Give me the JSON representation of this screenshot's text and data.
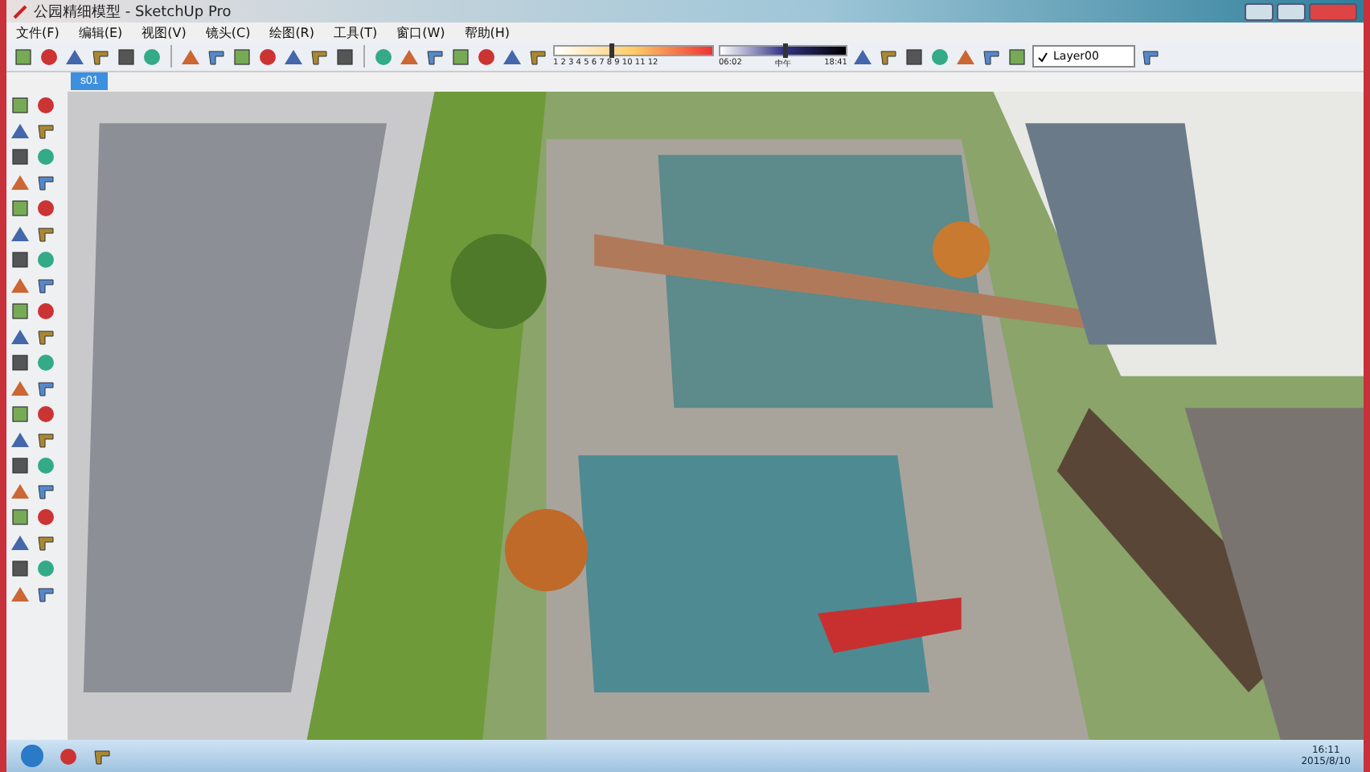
{
  "window": {
    "title": "公园精细模型 - SketchUp Pro"
  },
  "menu": [
    "文件(F)",
    "编辑(E)",
    "视图(V)",
    "镜头(C)",
    "绘图(R)",
    "工具(T)",
    "窗口(W)",
    "帮助(H)"
  ],
  "shadow": {
    "months": "1 2 3 4 5 6 7 8 9 10 11 12",
    "time_start": "06:02",
    "noon": "中午",
    "time_end": "18:41",
    "level": 0.35,
    "time_slider": {
      "level": 0.5
    }
  },
  "layer": {
    "value": "Layer00",
    "checked": true
  },
  "scene_tabs": [
    {
      "label": "s01",
      "selected": true
    }
  ],
  "taskbar": {
    "time": "16:11",
    "date": "2015/8/10"
  }
}
